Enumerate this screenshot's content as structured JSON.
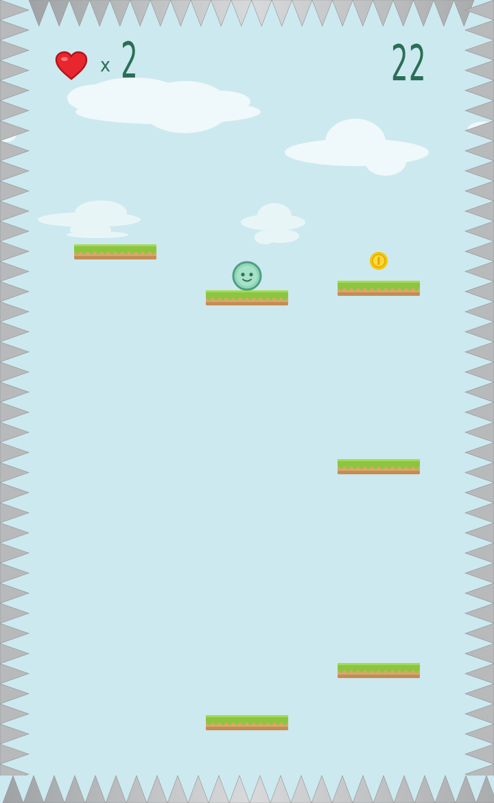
{
  "hud": {
    "lives_icon": "heart-icon",
    "lives_prefix": "x",
    "lives_count": "2",
    "score": "22"
  },
  "colors": {
    "sky": "#cce9ef",
    "heart": "#e8262d",
    "text": "#2b6e58",
    "grass": "#8cc63f",
    "dirt": "#d9a66b",
    "spike": "#b7b9bb",
    "coin": "#f7c600",
    "player": "#8fd6b5"
  },
  "entities": {
    "player": "green-smiley-ball",
    "coin": "gold-coin"
  }
}
